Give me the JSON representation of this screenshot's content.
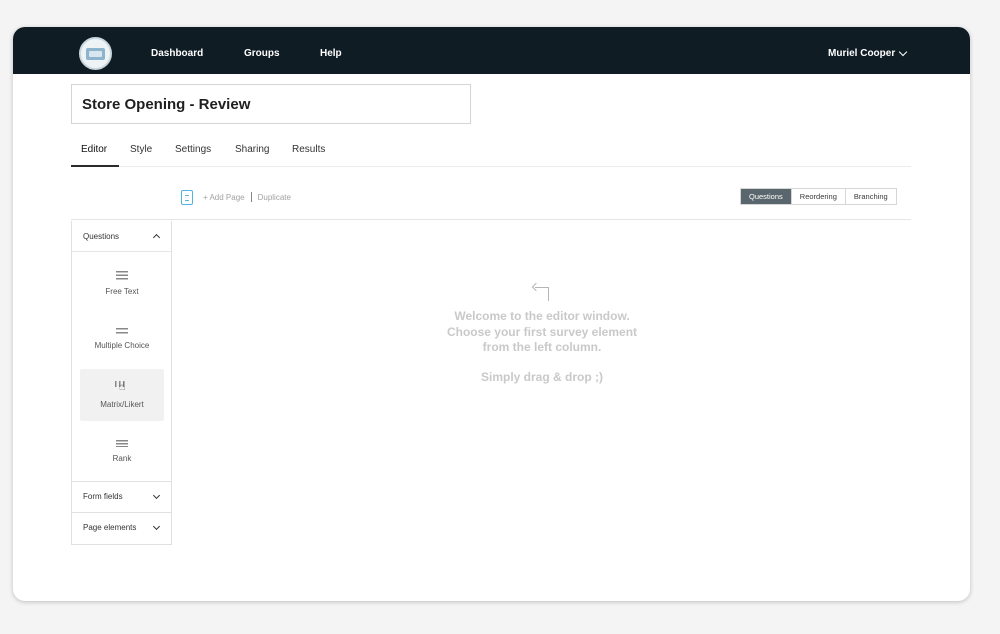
{
  "header": {
    "nav": [
      {
        "label": "Dashboard"
      },
      {
        "label": "Groups"
      },
      {
        "label": "Help"
      }
    ],
    "user_name": "Muriel Cooper"
  },
  "survey": {
    "title_value": "Store Opening - Review"
  },
  "tabs": [
    {
      "label": "Editor",
      "active": true
    },
    {
      "label": "Style"
    },
    {
      "label": "Settings"
    },
    {
      "label": "Sharing"
    },
    {
      "label": "Results"
    }
  ],
  "page_toolbar": {
    "add_page": "+ Add Page",
    "duplicate": "Duplicate"
  },
  "view_toggle": [
    {
      "label": "Questions",
      "active": true
    },
    {
      "label": "Reordering"
    },
    {
      "label": "Branching"
    }
  ],
  "left_panel": {
    "questions_label": "Questions",
    "items": [
      {
        "label": "Free Text",
        "icon": "free-text-icon"
      },
      {
        "label": "Multiple Choice",
        "icon": "multiple-choice-icon"
      },
      {
        "label": "Matrix/Likert",
        "icon": "matrix-likert-icon"
      },
      {
        "label": "Rank",
        "icon": "rank-icon"
      }
    ],
    "form_fields_label": "Form fields",
    "page_elements_label": "Page elements"
  },
  "canvas": {
    "welcome_line1": "Welcome to the editor window.",
    "welcome_line2": "Choose your first survey element",
    "welcome_line3": "from the left column.",
    "hint": "Simply drag & drop ;)"
  },
  "colors": {
    "topbar": "#0f1c24",
    "toggle_active": "#5a666d",
    "page_icon": "#52b5dd"
  }
}
